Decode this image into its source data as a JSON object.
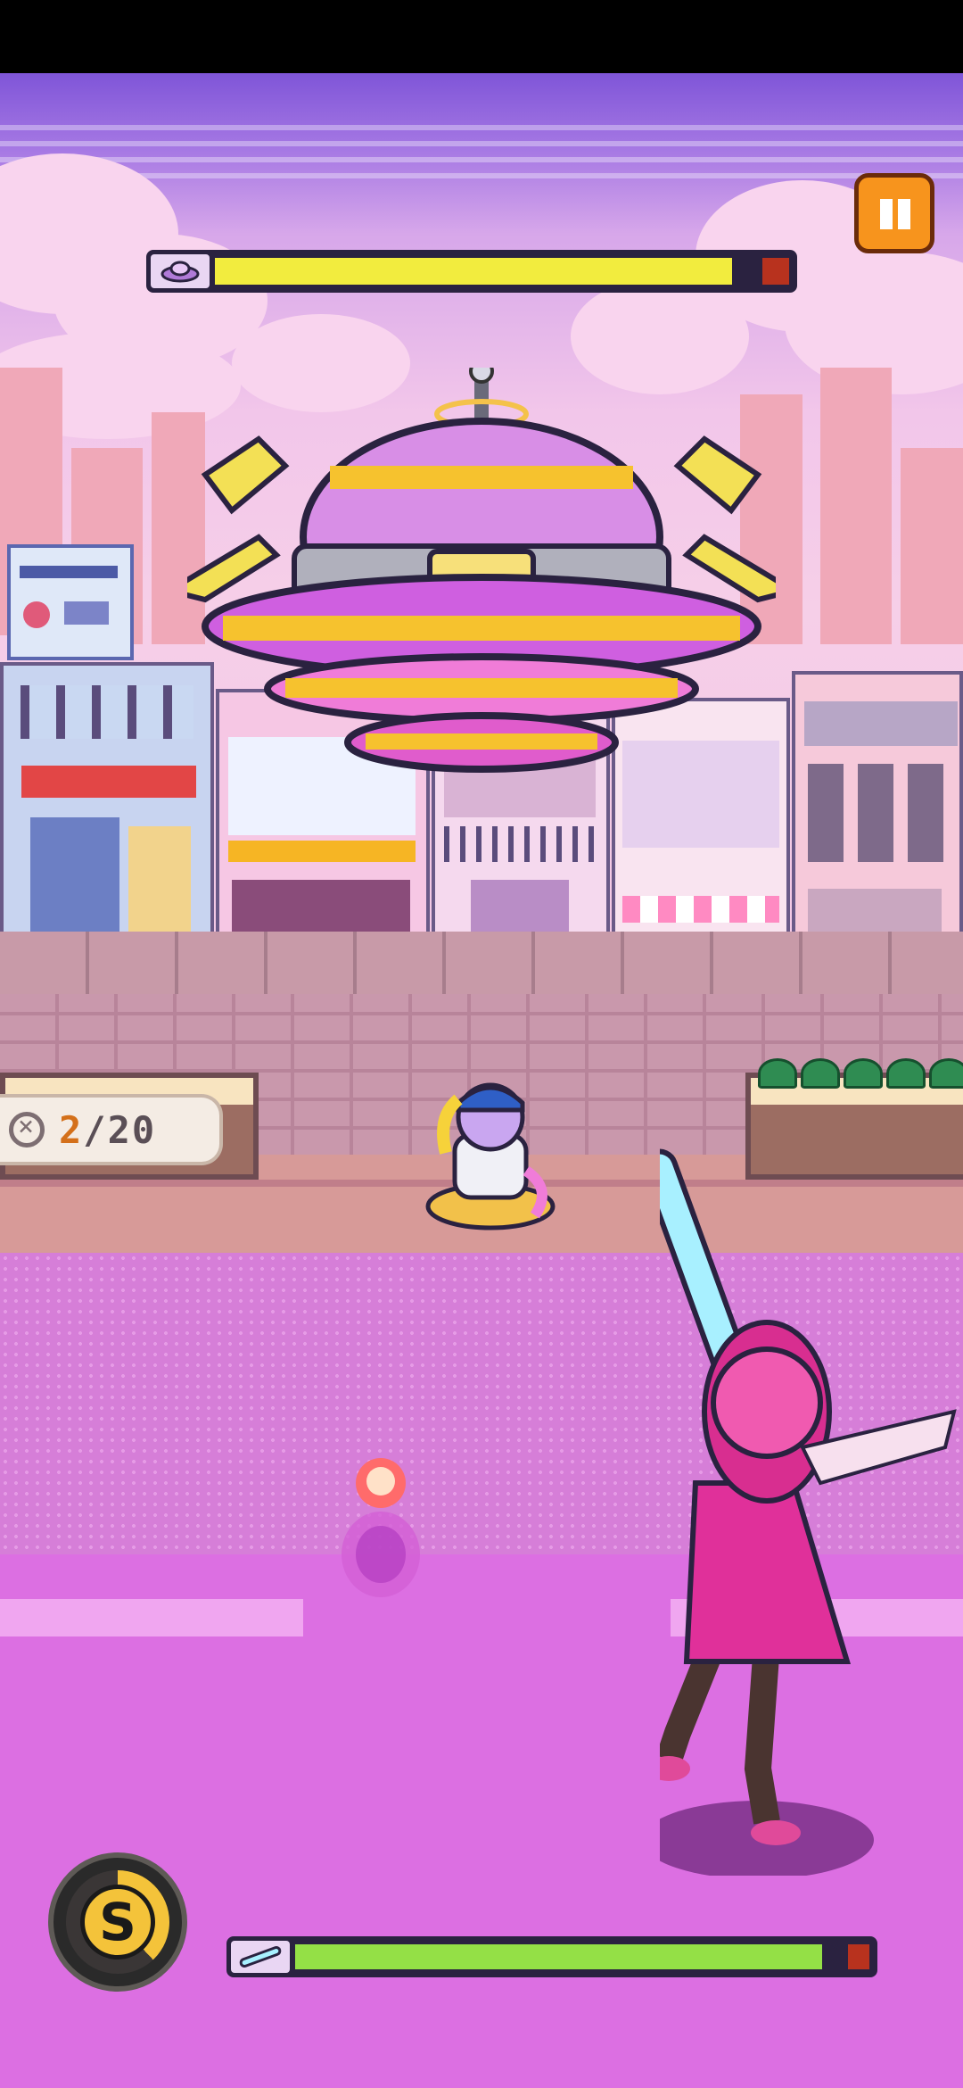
{
  "hud": {
    "boss_health": 0.95,
    "batter_power": 0.96,
    "special_charge": 0.38,
    "pause_icon": "pause-icon",
    "special_label": "S",
    "counter": {
      "current": "2",
      "separator": "/",
      "total": "20"
    }
  },
  "colors": {
    "boss_bar_fill": "#f2ec3e",
    "power_bar_fill": "#94e046",
    "pause_button": "#f7941d",
    "counter_current": "#d4701a"
  }
}
